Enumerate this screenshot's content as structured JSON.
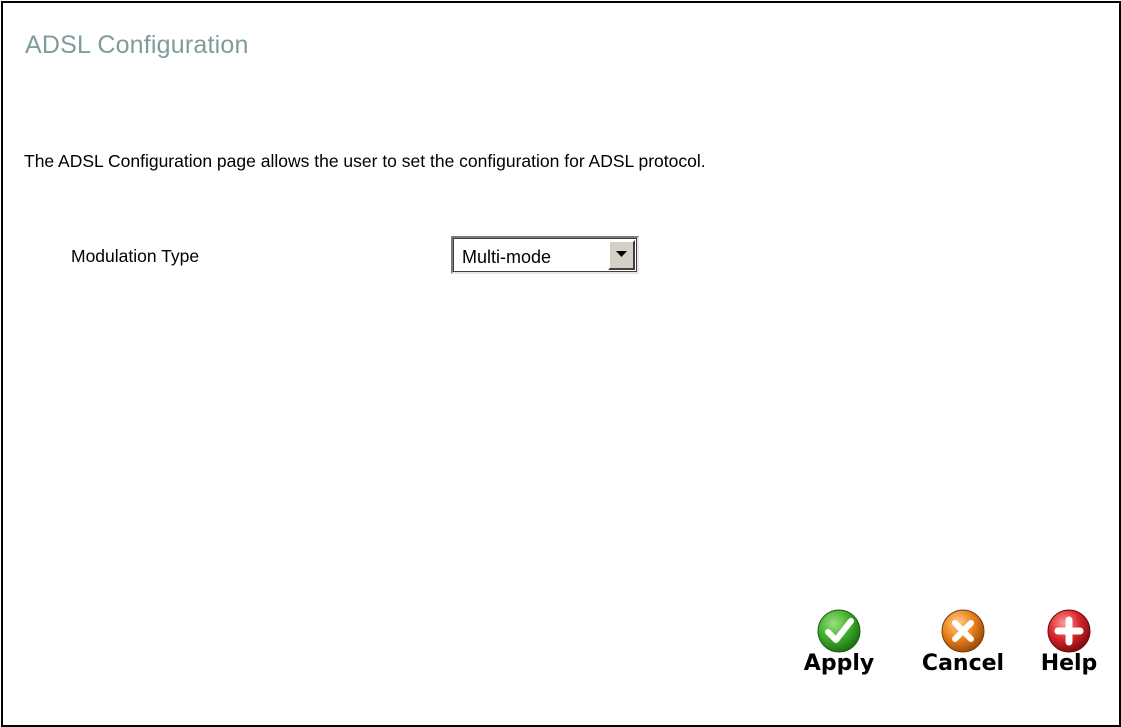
{
  "page": {
    "title": "ADSL Configuration",
    "description": "The ADSL Configuration page allows the user to set the configuration for ADSL protocol."
  },
  "form": {
    "modulation_label": "Modulation Type",
    "modulation_value": "Multi-mode"
  },
  "actions": {
    "apply": {
      "label": "Apply",
      "icon": "checkmark-icon",
      "color": "#3fae2a"
    },
    "cancel": {
      "label": "Cancel",
      "icon": "x-icon",
      "color": "#e8821c"
    },
    "help": {
      "label": "Help",
      "icon": "plus-icon",
      "color": "#d8232a"
    }
  },
  "colors": {
    "title": "#7f9c9c"
  }
}
